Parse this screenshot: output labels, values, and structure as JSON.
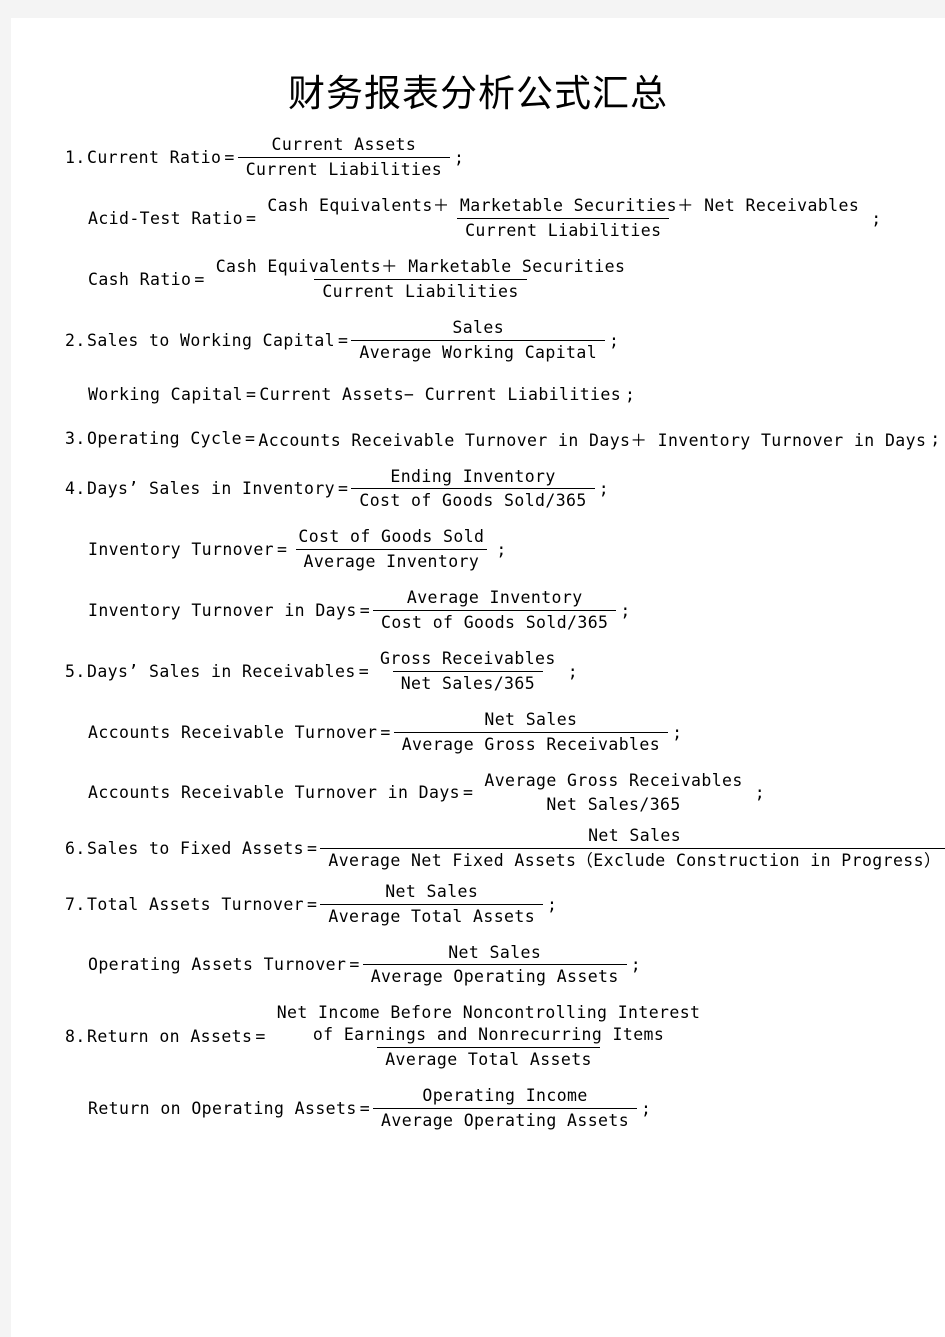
{
  "document": {
    "title": "财务报表分析公式汇总",
    "background_color": "#ffffff",
    "page_margin_color": "#f4f4f4",
    "text_color": "#000000"
  },
  "symbols": {
    "equals": "=",
    "plus": "+",
    "minus": "−",
    "semicolon": ";"
  },
  "formulas": [
    {
      "number": "1.",
      "name": "Current Ratio",
      "numerator": "Current Assets",
      "denominator": "Current Liabilities",
      "terminator": ";"
    },
    {
      "number": "",
      "name": "Acid-Test Ratio",
      "numerator": "Cash Equivalents＋ Marketable Securities＋ Net Receivables",
      "denominator": "Current Liabilities",
      "terminator": ";"
    },
    {
      "number": "",
      "name": "Cash Ratio",
      "numerator": "Cash Equivalents＋ Marketable Securities",
      "denominator": "Current Liabilities",
      "terminator": ""
    },
    {
      "number": "2.",
      "name": "Sales to Working Capital",
      "numerator": "Sales",
      "denominator": "Average Working Capital",
      "terminator": ";"
    },
    {
      "number": "",
      "name": "Working Capital",
      "inline_expression": "Current Assets− Current Liabilities",
      "terminator": ";"
    },
    {
      "number": "3.",
      "name": "Operating Cycle",
      "inline_expression": "Accounts Receivable Turnover in Days＋ Inventory Turnover in Days",
      "terminator": ";"
    },
    {
      "number": "4.",
      "name": "Days’ Sales in Inventory",
      "numerator": "Ending Inventory",
      "denominator": "Cost of Goods Sold/365",
      "terminator": ";"
    },
    {
      "number": "",
      "name": "Inventory Turnover",
      "numerator": "Cost of Goods Sold",
      "denominator": "Average Inventory",
      "terminator": ";"
    },
    {
      "number": "",
      "name": "Inventory Turnover in Days",
      "numerator": "Average Inventory",
      "denominator": "Cost of Goods Sold/365",
      "terminator": ";"
    },
    {
      "number": "5.",
      "name": "Days’ Sales in Receivables",
      "numerator": "Gross Receivables",
      "denominator": "Net Sales/365",
      "terminator": ";"
    },
    {
      "number": "",
      "name": "Accounts Receivable Turnover",
      "numerator": "Net Sales",
      "denominator": "Average Gross Receivables",
      "terminator": ";"
    },
    {
      "number": "",
      "name": "Accounts Receivable Turnover in Days",
      "numerator": "Average Gross Receivables",
      "denominator": "Net Sales/365",
      "bar_visible": false,
      "terminator": ";"
    },
    {
      "number": "6.",
      "name": "Sales to Fixed Assets",
      "numerator": "Net Sales",
      "denominator": "Average Net Fixed Assets（Exclude Construction in Progress）",
      "terminator": ";"
    },
    {
      "number": "7.",
      "name": "Total Assets Turnover",
      "numerator": "Net Sales",
      "denominator": "Average Total Assets",
      "terminator": ";"
    },
    {
      "number": "",
      "name": "Operating Assets Turnover",
      "numerator": "Net Sales",
      "denominator": "Average Operating Assets",
      "terminator": ";"
    },
    {
      "number": "8.",
      "name": "Return on Assets",
      "numerator_line1": "Net Income Before Noncontrolling Interest",
      "numerator_line2": "of Earnings and Nonrecurring Items",
      "denominator": "Average Total Assets",
      "terminator": ""
    },
    {
      "number": "",
      "name": "Return on Operating Assets",
      "numerator": "Operating Income",
      "denominator": "Average Operating Assets",
      "terminator": ";"
    }
  ]
}
